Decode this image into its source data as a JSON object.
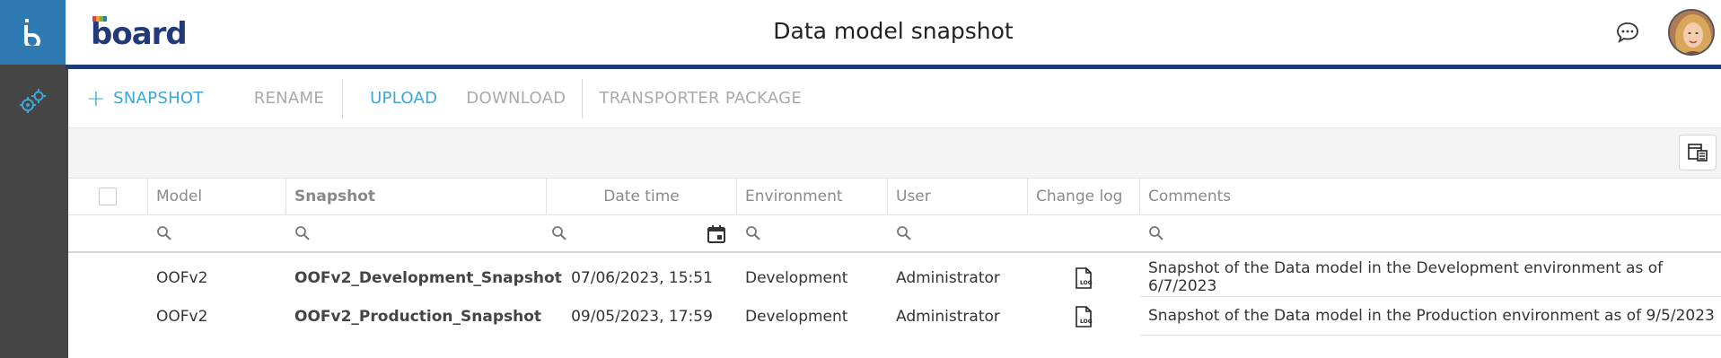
{
  "app": {
    "title": "Data model snapshot",
    "brand": "board",
    "brand_colors": {
      "primary": "#233a7a",
      "accent_blue": "#2e7bb4",
      "accent_red": "#e2413a",
      "accent_orange": "#f3a531",
      "accent_green": "#6cb33f"
    }
  },
  "toolbar": {
    "snapshot_label": "SNAPSHOT",
    "rename_label": "RENAME",
    "upload_label": "UPLOAD",
    "download_label": "DOWNLOAD",
    "transporter_label": "TRANSPORTER PACKAGE"
  },
  "table": {
    "columns": {
      "model": "Model",
      "snapshot": "Snapshot",
      "datetime": "Date time",
      "environment": "Environment",
      "user": "User",
      "changelog": "Change log",
      "comments": "Comments"
    },
    "rows": [
      {
        "model": "OOFv2",
        "snapshot": "OOFv2_Development_Snapshot",
        "datetime": "07/06/2023, 15:51",
        "environment": "Development",
        "user": "Administrator",
        "comments": "Snapshot of the Data model in the Development environment as of 6/7/2023"
      },
      {
        "model": "OOFv2",
        "snapshot": "OOFv2_Production_Snapshot",
        "datetime": "09/05/2023, 17:59",
        "environment": "Development",
        "user": "Administrator",
        "comments": "Snapshot of the Data model in the Production environment as of 9/5/2023"
      }
    ]
  },
  "icons": [
    "board-b-icon",
    "settings-gears-icon",
    "chat-icon",
    "avatar",
    "plus-icon",
    "column-chooser-icon",
    "search-icon",
    "calendar-icon",
    "log-file-icon"
  ]
}
